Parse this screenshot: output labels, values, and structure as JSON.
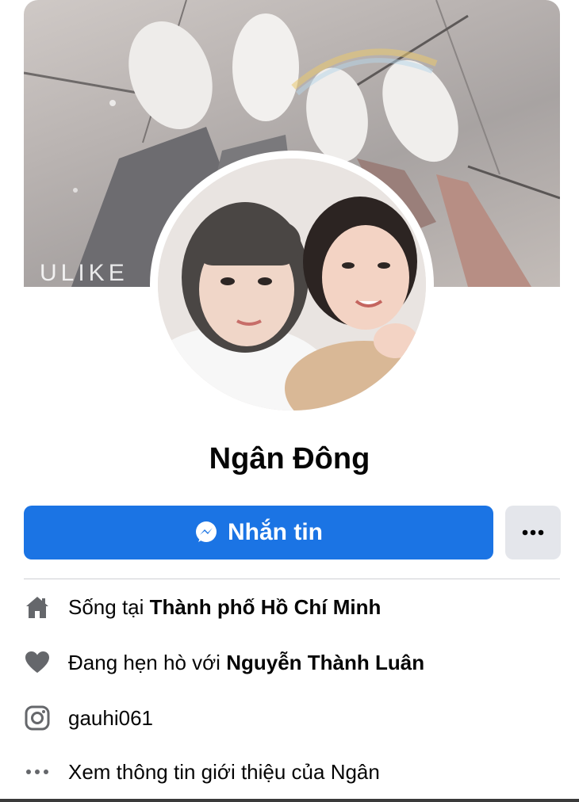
{
  "profile": {
    "name": "Ngân Đông",
    "cover_watermark": "ULIKE"
  },
  "actions": {
    "message_label": "Nhắn tin",
    "more_icon": "ellipsis-icon"
  },
  "intro": {
    "lives_prefix": "Sống tại ",
    "lives_place": "Thành phố Hồ Chí Minh",
    "dating_prefix": "Đang hẹn hò với ",
    "dating_partner": "Nguyễn Thành Luân",
    "instagram": "gauhi061",
    "see_about": "Xem thông tin giới thiệu của Ngân"
  },
  "colors": {
    "accent": "#1b74e4",
    "secondary_button": "#e4e6eb",
    "icon_gray": "#65676b"
  }
}
